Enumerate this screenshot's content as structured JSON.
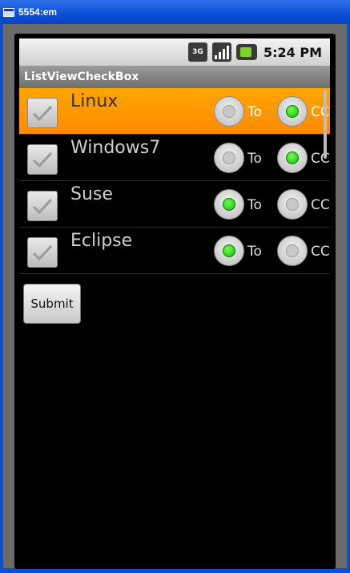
{
  "window": {
    "title": "5554:em"
  },
  "status_bar": {
    "network": "3G",
    "time": "5:24 PM"
  },
  "app": {
    "title": "ListViewCheckBox"
  },
  "list": {
    "items": [
      {
        "label": "Linux",
        "checked": true,
        "option_a": "To",
        "option_b": "CC",
        "selected_option": "b"
      },
      {
        "label": "Windows7",
        "checked": true,
        "option_a": "To",
        "option_b": "CC",
        "selected_option": "b"
      },
      {
        "label": "Suse",
        "checked": true,
        "option_a": "To",
        "option_b": "CC",
        "selected_option": "a"
      },
      {
        "label": "Eclipse",
        "checked": true,
        "option_a": "To",
        "option_b": "CC",
        "selected_option": "a"
      }
    ],
    "highlighted_index": 0
  },
  "submit": {
    "label": "Submit"
  },
  "colors": {
    "highlight": "#ff9800",
    "radio_on": "#22d60f"
  }
}
